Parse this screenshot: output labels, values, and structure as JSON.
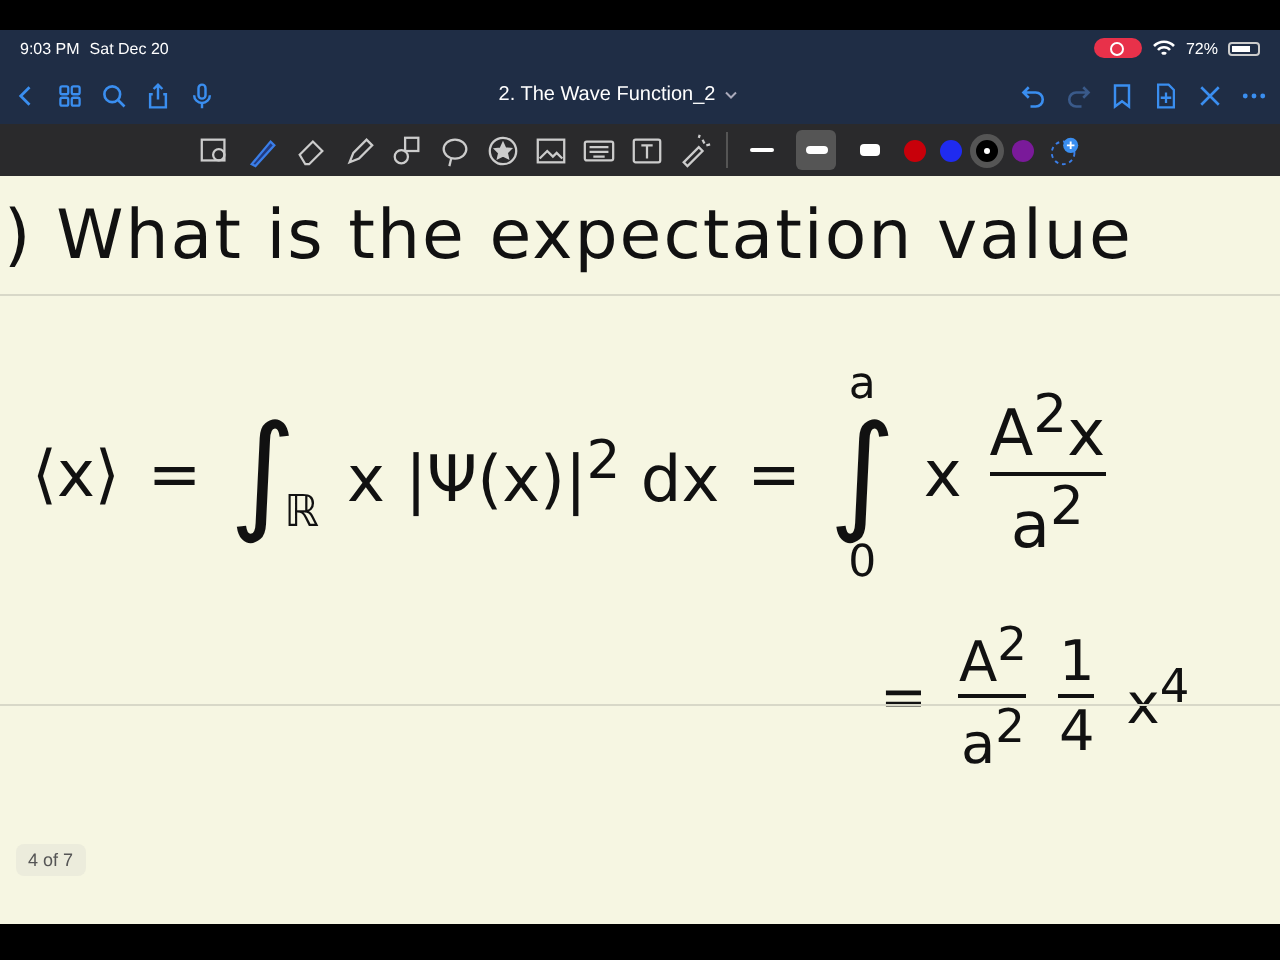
{
  "status_bar": {
    "time": "9:03 PM",
    "date": "Sat Dec 20",
    "battery": "72%",
    "recording": true
  },
  "nav": {
    "title": "2. The Wave Function_2"
  },
  "toolbar": {
    "tools": [
      {
        "kind": "zoom",
        "selected": false
      },
      {
        "kind": "pen",
        "selected": true
      },
      {
        "kind": "eraser",
        "selected": false
      },
      {
        "kind": "highlighter",
        "selected": false
      },
      {
        "kind": "shapes",
        "selected": false
      },
      {
        "kind": "lasso",
        "selected": false
      },
      {
        "kind": "sticker",
        "selected": false
      },
      {
        "kind": "image",
        "selected": false
      },
      {
        "kind": "keyboard",
        "selected": false
      },
      {
        "kind": "text",
        "selected": false
      },
      {
        "kind": "laser",
        "selected": false
      }
    ],
    "widths": [
      {
        "selected": false
      },
      {
        "selected": true
      },
      {
        "selected": false
      }
    ],
    "colors": [
      {
        "color": "#c8000a",
        "selected": false
      },
      {
        "color": "#1f2bf0",
        "selected": false
      },
      {
        "color": "#000000",
        "selected": true
      },
      {
        "color": "#7a1a9a",
        "selected": false
      }
    ]
  },
  "page": {
    "heading": ") What is the expectation value",
    "formula": {
      "lhs": "⟨x⟩",
      "eq1": "=",
      "int1_sign": "∫",
      "int2_sign": "∫",
      "int1_lower": "ℝ",
      "integrand1": "x |Ψ(x)|$^{2}$ dx",
      "eq2": "=",
      "int2_upper": "a",
      "int2_lower": "0",
      "factor": "x",
      "frac_num": "A$^{2}$x",
      "frac_den": "a$^{2}$"
    },
    "line2": {
      "eq": "=",
      "frac1_num": "A$^{2}$",
      "frac1_den": "a$^{2}$",
      "frac2_num": "1",
      "frac2_den": "4",
      "term": "x$^{4}$"
    },
    "page_indicator": "4 of 7"
  }
}
